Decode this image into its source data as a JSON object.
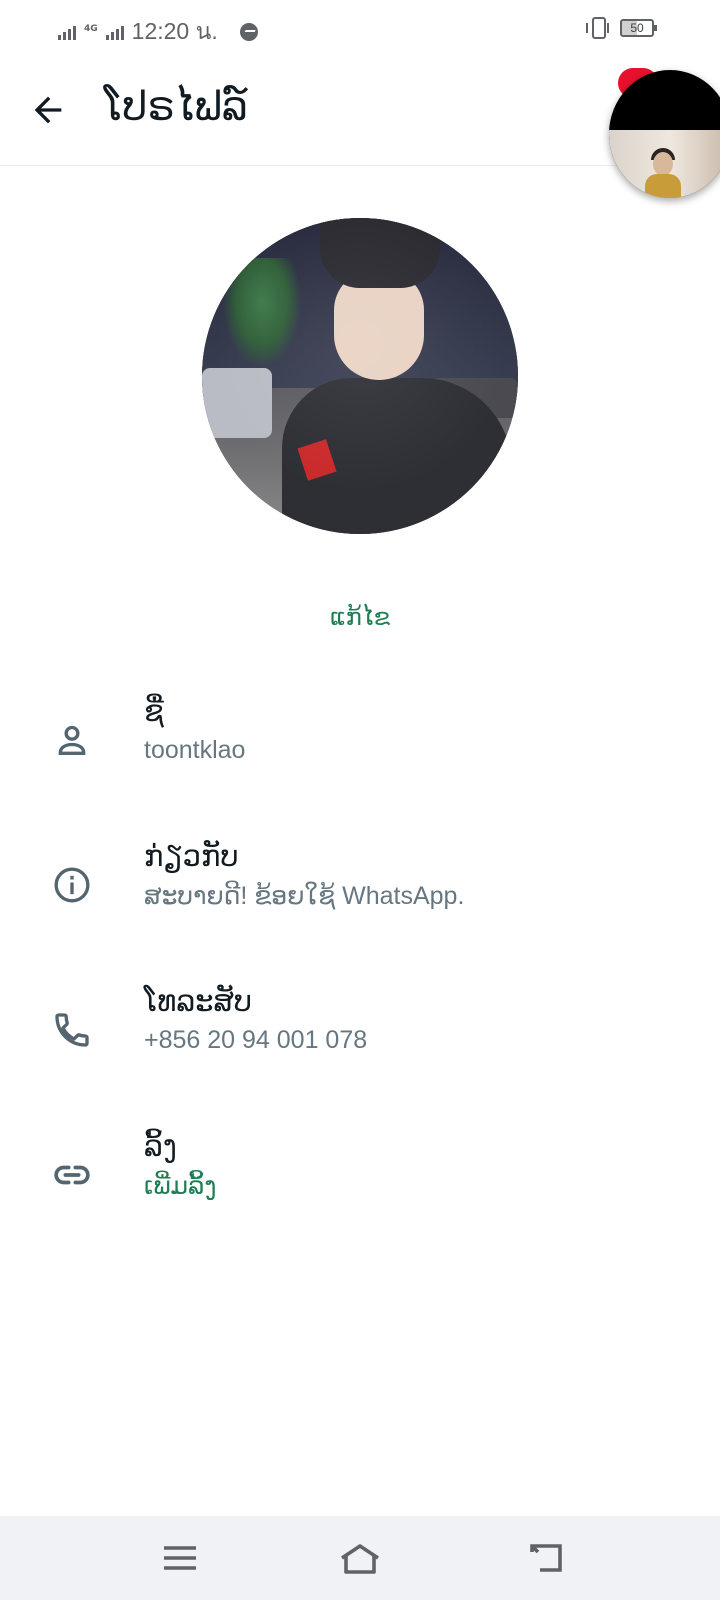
{
  "status_bar": {
    "network": "4G",
    "time": "12:20 น.",
    "battery": "50",
    "icons": [
      "signal-icon",
      "signal-icon",
      "messenger-icon",
      "vibrate-icon",
      "battery-icon"
    ]
  },
  "app_bar": {
    "title": "ໂປຣໄຟລ໌",
    "back_icon": "arrow-back-icon"
  },
  "profile": {
    "edit_label": "ແກ້ໄຂ"
  },
  "rows": [
    {
      "icon": "person-icon",
      "label": "ຊື່",
      "value": "toontklao"
    },
    {
      "icon": "info-icon",
      "label": "ກ່ຽວກັບ",
      "value": "ສະບາຍດີ! ຂ້ອຍໃຊ້ WhatsApp."
    },
    {
      "icon": "phone-icon",
      "label": "ໂທລະສັບ",
      "value": "+856 20 94 001 078"
    },
    {
      "icon": "link-icon",
      "label": "ລິ້ງ",
      "value": "ເພີ່ມລິ້ງ"
    }
  ],
  "colors": {
    "accent": "#1f7d53",
    "secondary_text": "#667781",
    "primary_text": "#111b21",
    "badge": "#e8112d"
  },
  "nav_bar": {
    "icons": [
      "menu-icon",
      "home-icon",
      "back-icon"
    ]
  }
}
